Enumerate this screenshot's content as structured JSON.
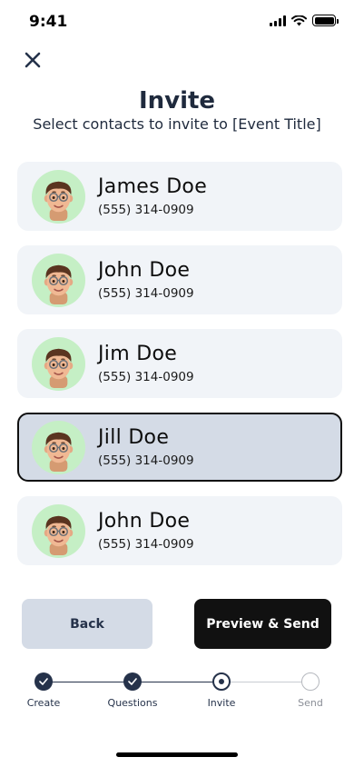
{
  "status_bar": {
    "time": "9:41"
  },
  "header": {
    "title": "Invite",
    "subtitle": "Select contacts to invite to [Event Title]"
  },
  "contacts": [
    {
      "name": "James Doe",
      "phone": "(555) 314-0909",
      "selected": false
    },
    {
      "name": "John Doe",
      "phone": "(555) 314-0909",
      "selected": false
    },
    {
      "name": "Jim Doe",
      "phone": "(555) 314-0909",
      "selected": false
    },
    {
      "name": "Jill Doe",
      "phone": "(555) 314-0909",
      "selected": true
    },
    {
      "name": "John Doe",
      "phone": "(555) 314-0909",
      "selected": false
    }
  ],
  "buttons": {
    "back_label": "Back",
    "send_label": "Preview & Send"
  },
  "stepper": {
    "steps": [
      {
        "label": "Create",
        "state": "done"
      },
      {
        "label": "Questions",
        "state": "done"
      },
      {
        "label": "Invite",
        "state": "current"
      },
      {
        "label": "Send",
        "state": "todo"
      }
    ]
  },
  "icons": {
    "close": "close-icon",
    "avatar": "memoji-avatar",
    "check": "check-icon"
  },
  "colors": {
    "accent": "#25324a",
    "card": "#f1f4f8",
    "card_selected": "#d4dbe6",
    "avatar_bg": "#c5efc5",
    "primary_button": "#111111"
  }
}
